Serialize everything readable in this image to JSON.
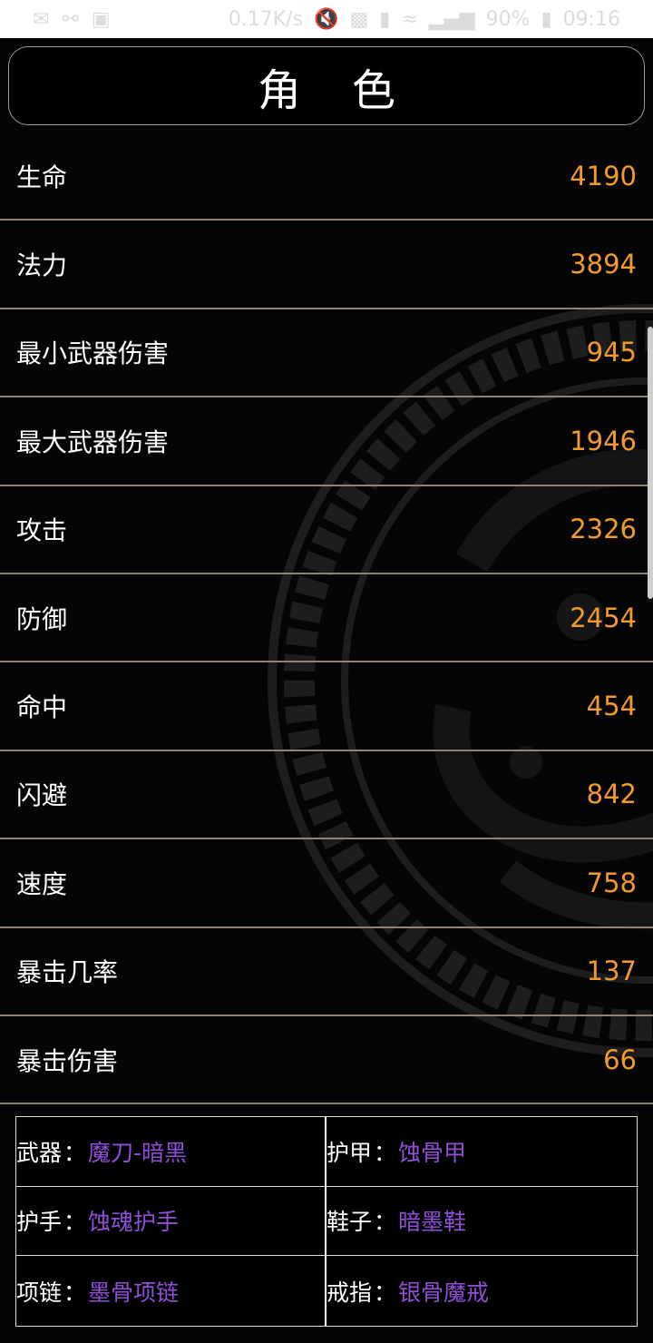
{
  "status_bar": {
    "net_speed": "0.17K/s",
    "battery": "90%",
    "time": "09:16"
  },
  "title": "角色",
  "stats": [
    {
      "label": "生命",
      "value": "4190"
    },
    {
      "label": "法力",
      "value": "3894"
    },
    {
      "label": "最小武器伤害",
      "value": "945"
    },
    {
      "label": "最大武器伤害",
      "value": "1946"
    },
    {
      "label": "攻击",
      "value": "2326"
    },
    {
      "label": "防御",
      "value": "2454"
    },
    {
      "label": "命中",
      "value": "454"
    },
    {
      "label": "闪避",
      "value": "842"
    },
    {
      "label": "速度",
      "value": "758"
    },
    {
      "label": "暴击几率",
      "value": "137"
    },
    {
      "label": "暴击伤害",
      "value": "66"
    }
  ],
  "equipment": [
    {
      "slot": "武器",
      "item": "魔刀-暗黑"
    },
    {
      "slot": "护甲",
      "item": "蚀骨甲"
    },
    {
      "slot": "护手",
      "item": "蚀魂护手"
    },
    {
      "slot": "鞋子",
      "item": "暗墨鞋"
    },
    {
      "slot": "项链",
      "item": "墨骨项链"
    },
    {
      "slot": "戒指",
      "item": "银骨魔戒"
    }
  ],
  "colors": {
    "value": "#f29a2e",
    "item": "#8e4fd6",
    "divider": "#8d8475"
  },
  "icons": [
    "message-icon",
    "usb-icon",
    "image-icon",
    "mute-icon",
    "nfc-icon",
    "hd-icon",
    "wifi-icon",
    "signal-icon",
    "battery-icon"
  ]
}
